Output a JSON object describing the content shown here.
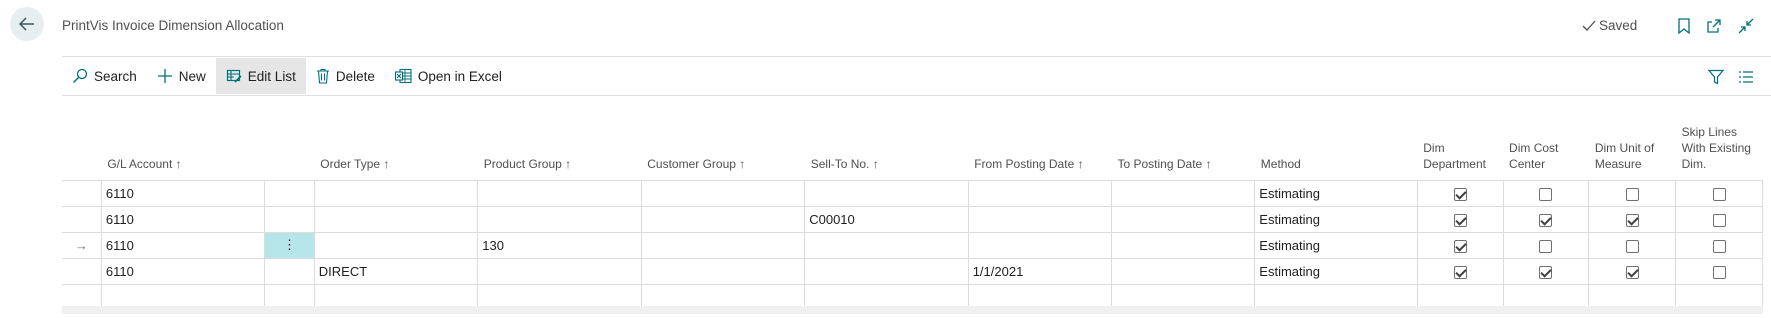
{
  "header": {
    "title": "PrintVis Invoice Dimension Allocation",
    "saved_label": "Saved"
  },
  "actions": {
    "search": "Search",
    "new": "New",
    "edit_list": "Edit List",
    "delete": "Delete",
    "open_in_excel": "Open in Excel"
  },
  "columns": {
    "gl_account": "G/L Account ↑",
    "order_type": "Order Type ↑",
    "product_group": "Product Group ↑",
    "customer_group": "Customer Group ↑",
    "sell_to_no": "Sell-To No. ↑",
    "from_posting_date": "From Posting Date ↑",
    "to_posting_date": "To Posting Date ↑",
    "method": "Method",
    "dim_department": "Dim Department",
    "dim_cost_center": "Dim Cost Center",
    "dim_unit_of_measure": "Dim Unit of Measure",
    "skip_lines": "Skip Lines With Existing Dim."
  },
  "rows": [
    {
      "indicator": "",
      "gl_account": "6110",
      "order_type": "",
      "product_group": "",
      "customer_group": "",
      "sell_to_no": "",
      "from_posting_date": "",
      "to_posting_date": "",
      "method": "Estimating",
      "dim_department": true,
      "dim_cost_center": false,
      "dim_unit_of_measure": false,
      "skip_lines": false
    },
    {
      "indicator": "",
      "gl_account": "6110",
      "order_type": "",
      "product_group": "",
      "customer_group": "",
      "sell_to_no": "C00010",
      "from_posting_date": "",
      "to_posting_date": "",
      "method": "Estimating",
      "dim_department": true,
      "dim_cost_center": true,
      "dim_unit_of_measure": true,
      "skip_lines": false
    },
    {
      "indicator": "→",
      "gl_account": "6110",
      "order_type": "",
      "product_group": "130",
      "customer_group": "",
      "sell_to_no": "",
      "from_posting_date": "",
      "to_posting_date": "",
      "method": "Estimating",
      "dim_department": true,
      "dim_cost_center": false,
      "dim_unit_of_measure": false,
      "skip_lines": false
    },
    {
      "indicator": "",
      "gl_account": "6110",
      "order_type": "DIRECT",
      "product_group": "",
      "customer_group": "",
      "sell_to_no": "",
      "from_posting_date": "1/1/2021",
      "to_posting_date": "",
      "method": "Estimating",
      "dim_department": true,
      "dim_cost_center": true,
      "dim_unit_of_measure": true,
      "skip_lines": false
    }
  ],
  "focused_row_menu_glyph": "⋮",
  "colors": {
    "accent": "#00707a",
    "row_focus": "#b7e6ea",
    "active_action": "#e6e6e6"
  },
  "icons": [
    "back-arrow-icon",
    "checkmark-icon",
    "bookmark-icon",
    "open-new-window-icon",
    "collapse-icon",
    "search-icon",
    "plus-icon",
    "edit-list-icon",
    "trash-icon",
    "excel-icon",
    "filter-icon",
    "list-view-icon",
    "row-arrow-icon",
    "row-menu-icon"
  ]
}
